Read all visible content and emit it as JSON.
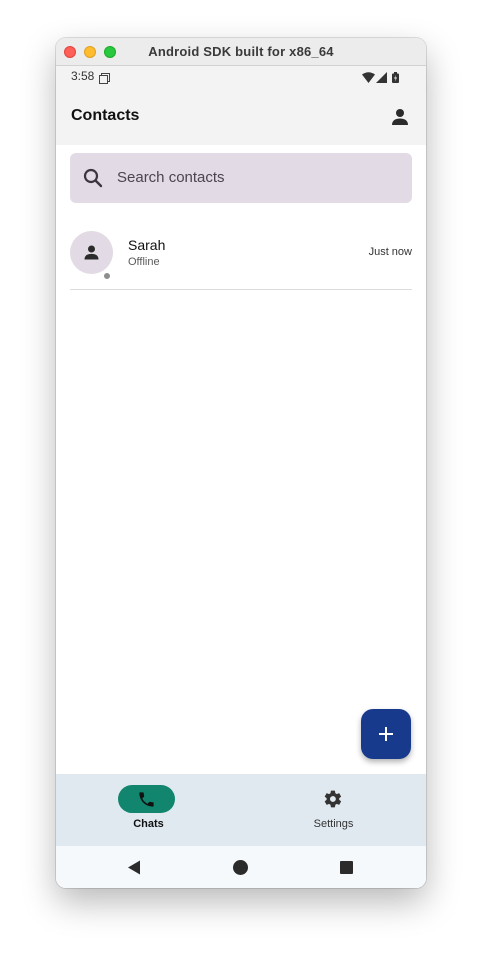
{
  "window": {
    "title": "Android SDK built for x86_64"
  },
  "status_bar": {
    "time": "3:58"
  },
  "app_bar": {
    "title": "Contacts"
  },
  "search": {
    "placeholder": "Search contacts"
  },
  "contacts": [
    {
      "name": "Sarah",
      "status": "Offline",
      "time": "Just now"
    }
  ],
  "bottom_nav": {
    "items": [
      {
        "label": "Chats",
        "icon": "phone-icon",
        "active": true
      },
      {
        "label": "Settings",
        "icon": "gear-icon",
        "active": false
      }
    ]
  },
  "colors": {
    "accent": "#12856e",
    "fab": "#173a8c",
    "search_bg": "#e2dae4",
    "nav_bg": "#e0e9f0"
  }
}
